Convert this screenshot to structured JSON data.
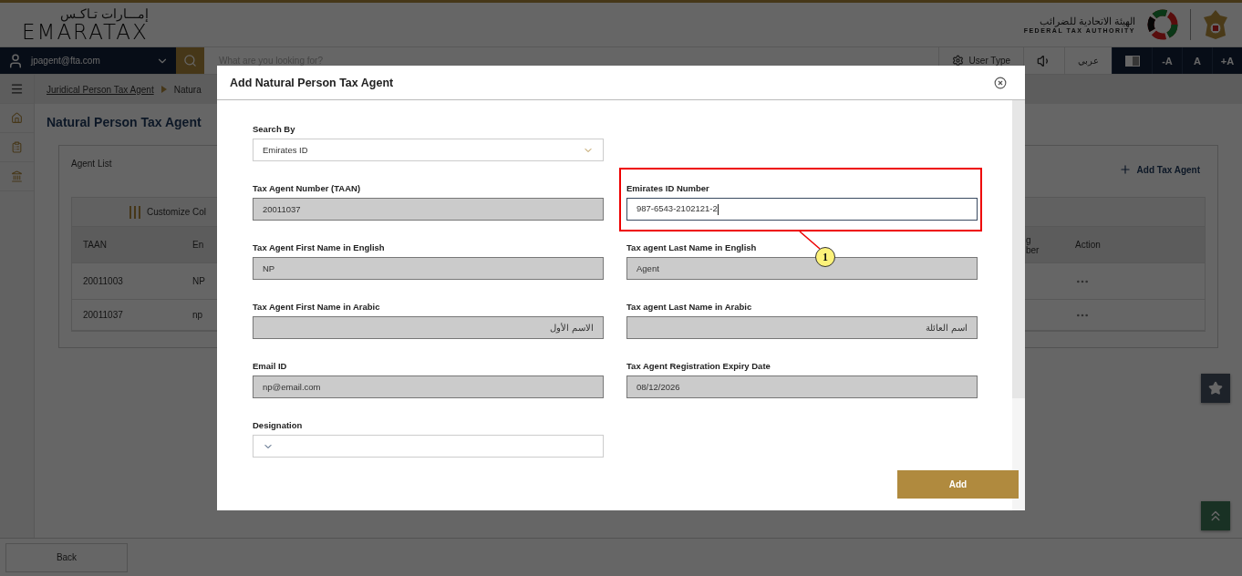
{
  "header": {
    "logo_arabic": "إمـــارات تـاكـس",
    "logo": "EMARATAX",
    "authority_arabic": "الهيئة الاتحادية للضرائب",
    "authority": "FEDERAL TAX AUTHORITY"
  },
  "nav": {
    "user": "jpagent@fta.com",
    "search_placeholder": "What are you looking for?",
    "user_type": "User Type",
    "language": "عربي",
    "font_buttons": [
      "-A",
      "A",
      "+A"
    ]
  },
  "breadcrumb": [
    {
      "label": "Juridical Person Tax Agent",
      "link": true
    },
    {
      "label": "Natura",
      "link": false
    }
  ],
  "page_title": "Natural Person Tax Agent",
  "agent_list": {
    "title": "Agent List",
    "add_button": "Add Tax Agent",
    "customize": "Customize Col",
    "columns": [
      "TAAN",
      "En",
      "g\nber",
      "Action"
    ],
    "rows": [
      [
        "20011003",
        "NP"
      ],
      [
        "20011037",
        "np"
      ]
    ]
  },
  "back_button": "Back",
  "modal": {
    "title": "Add Natural Person Tax Agent",
    "search_by": {
      "label": "Search By",
      "value": "Emirates ID"
    },
    "fields": [
      {
        "label": "Tax Agent Number (TAAN)",
        "value": "20011037",
        "kind": "input",
        "disabled": true
      },
      {
        "label": "Emirates ID Number",
        "value": "987-6543-2102121-2",
        "kind": "input",
        "disabled": false,
        "focused": true,
        "callout": "1"
      },
      {
        "label": "Tax Agent First Name in English",
        "value": "NP",
        "kind": "input",
        "disabled": true
      },
      {
        "label": "Tax agent Last Name in English",
        "value": "Agent",
        "kind": "input",
        "disabled": true
      },
      {
        "label": "Tax Agent First Name in Arabic",
        "value": "الاسم الأول",
        "kind": "rtl_input",
        "disabled": true
      },
      {
        "label": "Tax agent Last Name in Arabic",
        "value": "اسم العائلة",
        "kind": "rtl_input",
        "disabled": true
      },
      {
        "label": "Email ID",
        "value": "np@email.com",
        "kind": "input",
        "disabled": true
      },
      {
        "label": "Tax Agent Registration Expiry Date",
        "value": "08/12/2026",
        "kind": "input",
        "disabled": true
      },
      {
        "label": "Designation",
        "kind": "select",
        "disabled": false
      }
    ],
    "add_button": "Add"
  }
}
